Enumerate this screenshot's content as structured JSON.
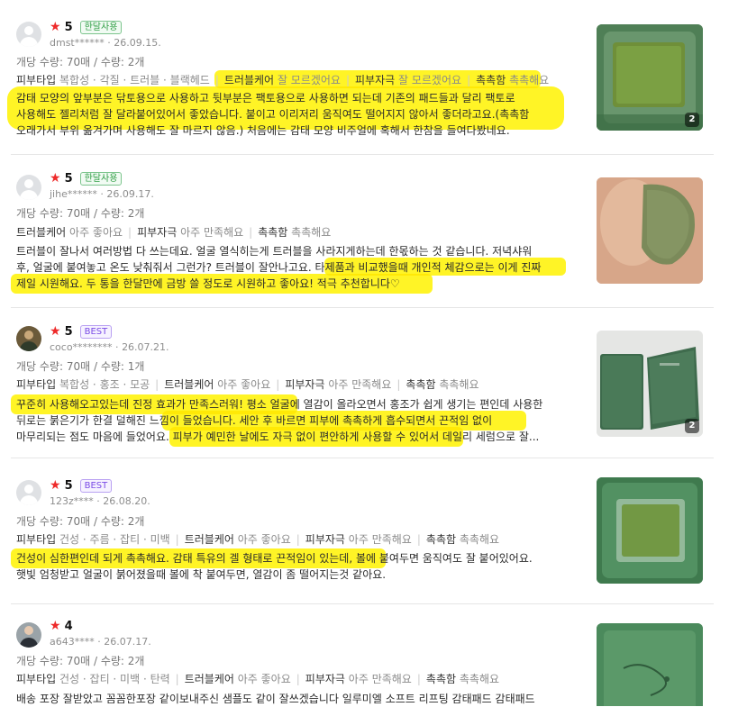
{
  "reviews": [
    {
      "rating": "5",
      "badge": "한달사용",
      "user": "dmst******",
      "date": "26.09.15.",
      "qty": "개당 수량: 70매 / 수량: 2개",
      "tags": [
        {
          "k": "피부타입",
          "v": "복합성 · 각질 · 트러블 · 블랙헤드"
        },
        {
          "k": "트러블케어",
          "v": "잘 모르겠어요"
        },
        {
          "k": "피부자극",
          "v": "잘 모르겠어요"
        },
        {
          "k": "촉촉함",
          "v": "촉촉해요"
        }
      ],
      "text": [
        "감태 모양의 앞부분은 닦토용으로 사용하고 뒷부분은 팩토용으로 사용하면 되는데 기존의 패드들과 달리 팩토로",
        "사용해도 젤리처럼 잘 달라붙어있어서 좋았습니다. 붙이고 이리저리 움직여도 떨어지지 않아서 좋더라고요.(촉촉함",
        "오래가서 부위 옮겨가며 사용해도 잘 마르지 않음.) 처음에는 감태 모양 비주얼에 혹해서 한참을 들여다봤네요."
      ],
      "photo_count": "2"
    },
    {
      "rating": "5",
      "badge": "한달사용",
      "user": "jihe******",
      "date": "26.09.17.",
      "qty": "개당 수량: 70매 / 수량: 2개",
      "tags": [
        {
          "k": "트러블케어",
          "v": "아주 좋아요"
        },
        {
          "k": "피부자극",
          "v": "아주 만족해요"
        },
        {
          "k": "촉촉함",
          "v": "촉촉해요"
        }
      ],
      "text": [
        "트러블이 잘나서 여러방법 다 쓰는데요. 얼굴 열식히는게 트러블을 사라지게하는데 한몫하는 것 같습니다. 저녁샤워",
        "후, 얼굴에 붙여놓고 온도 낮춰줘서 그런가? 트러블이 잘안나고요. 타제품과 비교했을때 개인적 체감으로는 이게 진짜",
        "제일 시원해요. 두 통을 한달만에 금방 쓸 정도로 시원하고 좋아요! 적극 추천합니다♡"
      ],
      "photo_count": ""
    },
    {
      "rating": "5",
      "badge": "BEST",
      "user": "coco********",
      "date": "26.07.21.",
      "qty": "개당 수량: 70매 / 수량: 1개",
      "tags": [
        {
          "k": "피부타입",
          "v": "복합성 · 홍조 · 모공"
        },
        {
          "k": "트러블케어",
          "v": "아주 좋아요"
        },
        {
          "k": "피부자극",
          "v": "아주 만족해요"
        },
        {
          "k": "촉촉함",
          "v": "촉촉해요"
        }
      ],
      "text": [
        "꾸준히 사용해오고있는데 진정 효과가 만족스러워! 평소 얼굴에 열감이 올라오면서 홍조가 쉽게 생기는 편인데 사용한",
        "뒤로는 붉은기가 한결 덜해진 느낌이 들었습니다. 세안 후 바르면 피부에 촉촉하게 흡수되면서 끈적임 없이",
        "마무리되는 점도 마음에 들었어요. 피부가 예민한 날에도 자극 없이 편안하게 사용할 수 있어서 데일리 세럼으로 잘..."
      ],
      "photo_count": "2"
    },
    {
      "rating": "5",
      "badge": "BEST",
      "user": "123z****",
      "date": "26.08.20.",
      "qty": "개당 수량: 70매 / 수량: 2개",
      "tags": [
        {
          "k": "피부타입",
          "v": "건성 · 주름 · 잡티 · 미백"
        },
        {
          "k": "트러블케어",
          "v": "아주 좋아요"
        },
        {
          "k": "피부자극",
          "v": "아주 만족해요"
        },
        {
          "k": "촉촉함",
          "v": "촉촉해요"
        }
      ],
      "text": [
        "건성이 심한편인데 되게 촉촉해요. 감태 특유의 겔 형태로 끈적임이 있는데, 볼에 붙여두면 움직여도 잘 붙어있어요.",
        "햇빛 엄청받고 얼굴이 붉어졌을때 볼에 착 붙여두면, 열감이 좀 떨어지는것 같아요."
      ],
      "photo_count": ""
    },
    {
      "rating": "4",
      "badge": "",
      "user": "a643****",
      "date": "26.07.17.",
      "qty": "개당 수량: 70매 / 수량: 2개",
      "tags": [
        {
          "k": "피부타입",
          "v": "건성 · 잡티 · 미백 · 탄력"
        },
        {
          "k": "트러블케어",
          "v": "아주 좋아요"
        },
        {
          "k": "피부자극",
          "v": "아주 만족해요"
        },
        {
          "k": "촉촉함",
          "v": "촉촉해요"
        }
      ],
      "text": [
        "배송 포장 잘받았고 꼼꼼한포장 같이보내주신 샘플도 같이 잘쓰겠습니다 일루미엘 소프트 리프팅 감태패드 감태패드"
      ],
      "photo_count": ""
    }
  ]
}
